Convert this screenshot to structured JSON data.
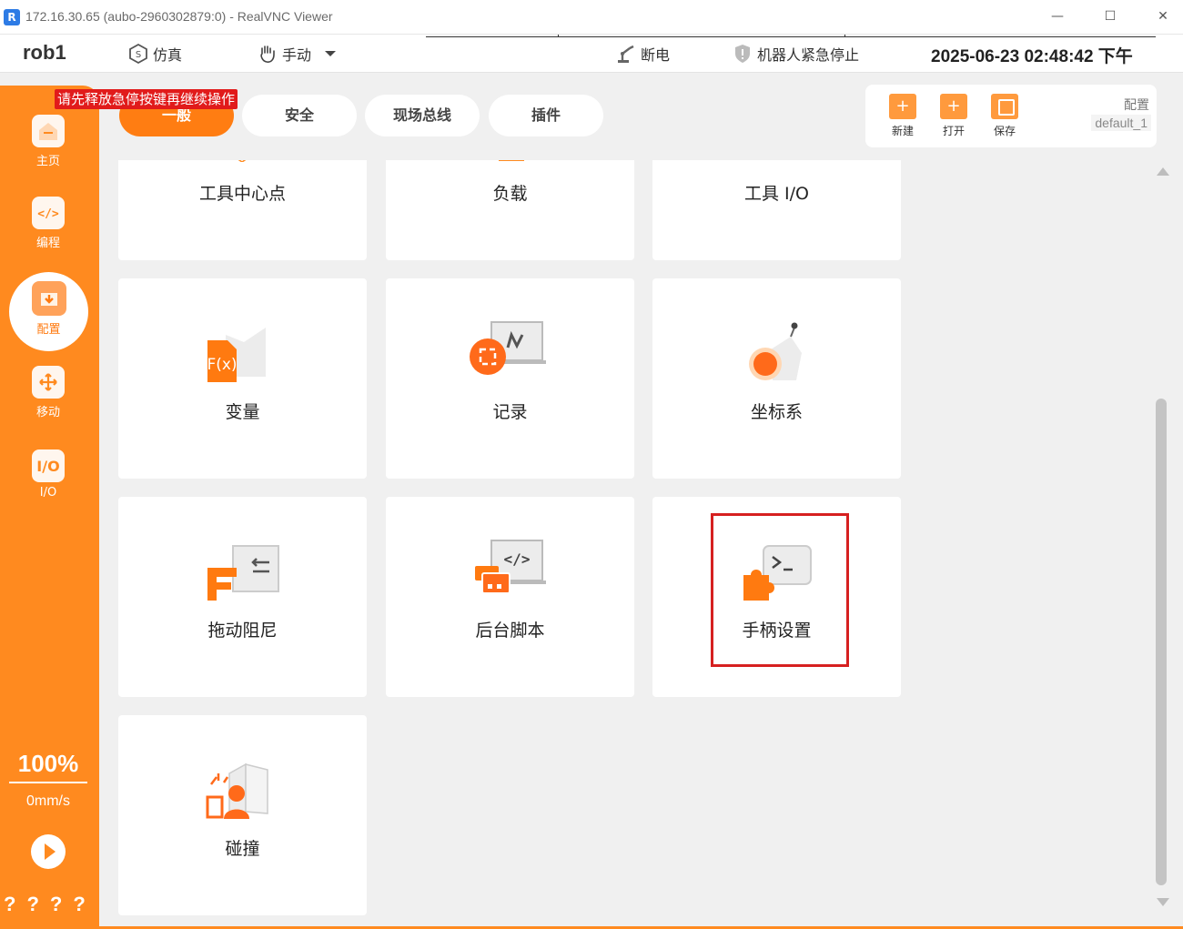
{
  "window": {
    "title": "172.16.30.65 (aubo-2960302879:0) - RealVNC Viewer",
    "logo": "R",
    "minimize": "—",
    "maximize": "☐",
    "close": "✕"
  },
  "header": {
    "robot_name": "rob1",
    "sim_label": "仿真",
    "manual_label": "手动",
    "power_label": "断电",
    "estop_label": "机器人紧急停止",
    "datetime": "2025-06-23 02:48:42 下午"
  },
  "sidebar": {
    "items": [
      {
        "label": "主页",
        "icon": "home-icon"
      },
      {
        "label": "编程",
        "icon": "code-icon"
      },
      {
        "label": "配置",
        "icon": "config-icon"
      },
      {
        "label": "移动",
        "icon": "move-icon"
      },
      {
        "label": "I/O",
        "icon": "io-icon"
      }
    ],
    "speed_percent": "100%",
    "speed_value": "0mm/s",
    "bottom_marks": "????"
  },
  "warning": "请先释放急停按键再继续操作",
  "tabs": [
    {
      "label": "一般",
      "active": true
    },
    {
      "label": "安全",
      "active": false
    },
    {
      "label": "现场总线",
      "active": false
    },
    {
      "label": "插件",
      "active": false
    }
  ],
  "config_panel": {
    "new_label": "新建",
    "open_label": "打开",
    "save_label": "保存",
    "config_label": "配置",
    "config_value": "default_1"
  },
  "cards": {
    "tcp": "工具中心点",
    "payload": "负载",
    "tool_io": "工具 I/O",
    "variables": "变量",
    "record": "记录",
    "coordinate": "坐标系",
    "drag_damping": "拖动阻尼",
    "background_script": "后台脚本",
    "handle_settings": "手柄设置",
    "collision": "碰撞"
  },
  "colors": {
    "accent": "#ff8a1f",
    "highlight": "#d62020",
    "warning": "#e11b1b"
  }
}
